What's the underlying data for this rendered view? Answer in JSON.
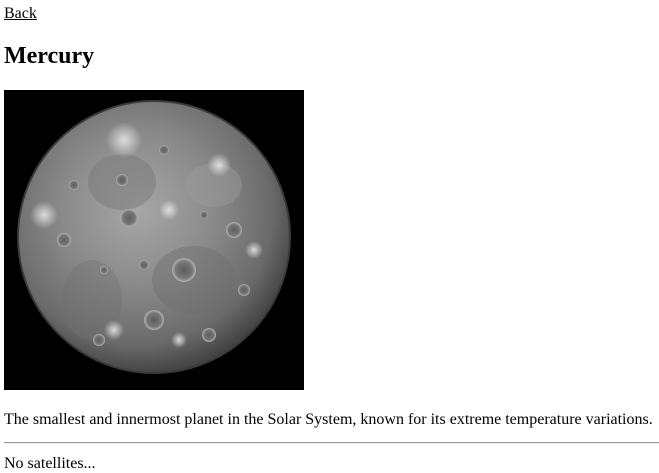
{
  "nav": {
    "back_label": "Back"
  },
  "planet": {
    "name": "Mercury",
    "image_icon": "mercury-planet-image",
    "description": "The smallest and innermost planet in the Solar System, known for its extreme temperature variations.",
    "satellites_text": "No satellites..."
  },
  "colors": {
    "background": "#ffffff",
    "text": "#000000",
    "image_backdrop": "#000000",
    "divider": "#9a9a9a"
  }
}
